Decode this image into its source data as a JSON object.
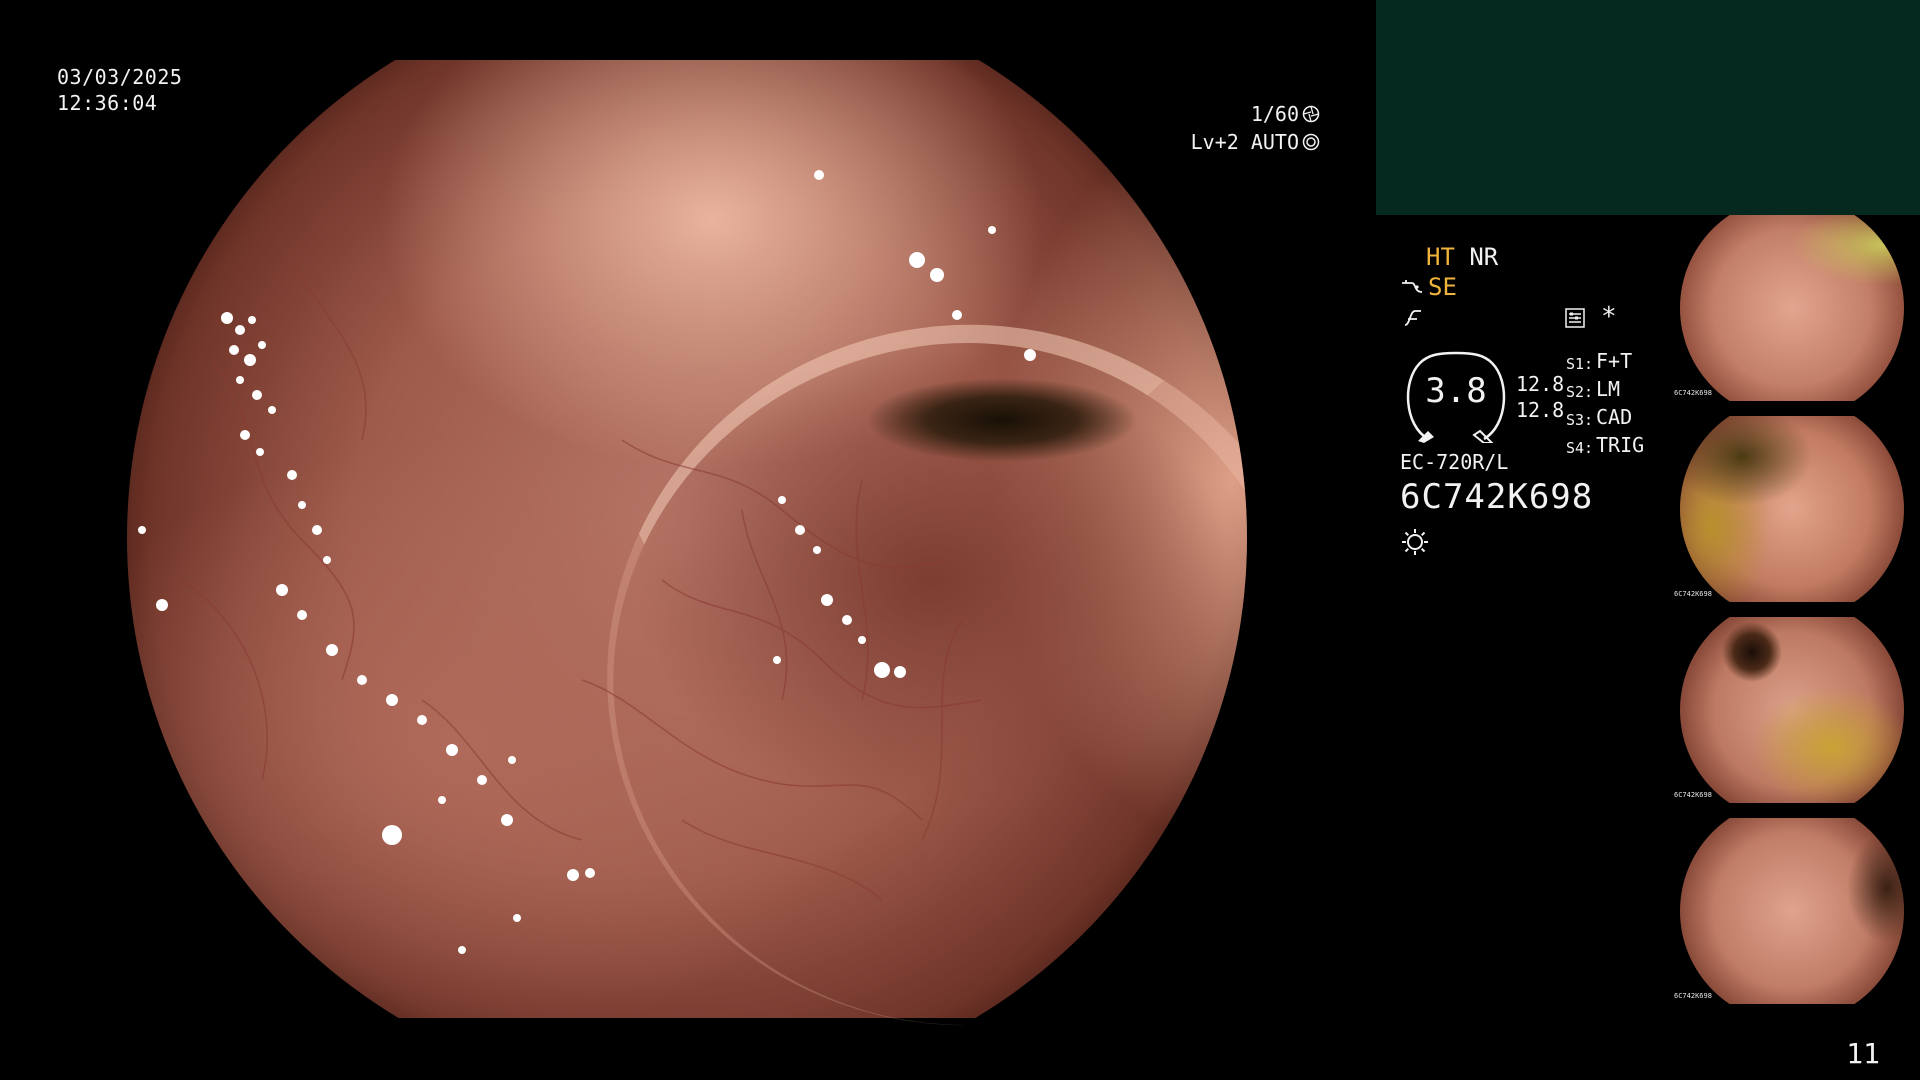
{
  "overlay": {
    "date": "03/03/2025",
    "time": "12:36:04",
    "shutter": "1/60",
    "level": "Lv+2 AUTO"
  },
  "panel": {
    "ht_label": "HT",
    "nr_label": "NR",
    "se_label": "SE",
    "zoom_value": "3.8",
    "scale_top": "12.8",
    "scale_bottom": "12.8",
    "modes": [
      {
        "key": "S1:",
        "value": "F+T"
      },
      {
        "key": "S2:",
        "value": "LM"
      },
      {
        "key": "S3:",
        "value": "CAD"
      },
      {
        "key": "S4:",
        "value": "TRIG"
      }
    ],
    "scope_model": "EC-720R/L",
    "serial": "6C742K698",
    "asterisk": "*"
  },
  "thumbnails": [
    {
      "label": "6C742K698"
    },
    {
      "label": "6C742K698"
    },
    {
      "label": "6C742K698"
    },
    {
      "label": "6C742K698"
    }
  ],
  "page_number": "11",
  "colors": {
    "highlight": "#f0b43c",
    "panel_bg": "#05281f",
    "text": "#f2f2f2"
  }
}
